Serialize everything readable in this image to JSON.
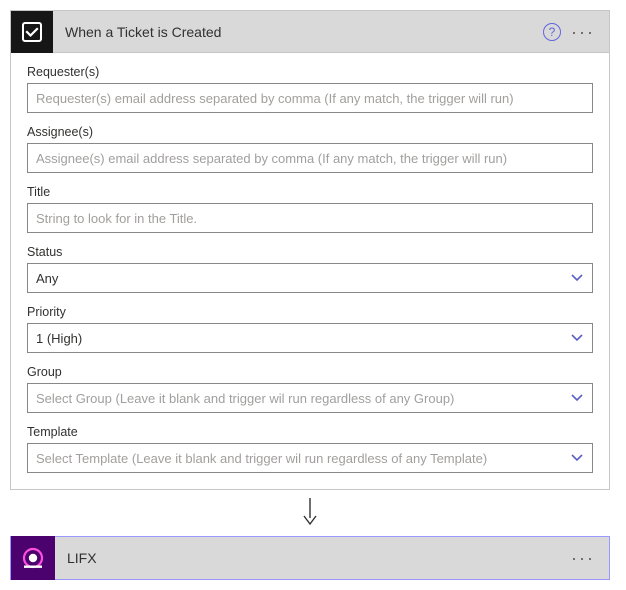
{
  "triggerCard": {
    "title": "When a Ticket is Created",
    "helpTooltip": "?",
    "fields": {
      "requester": {
        "label": "Requester(s)",
        "placeholder": "Requester(s) email address separated by comma (If any match, the trigger will run)",
        "value": ""
      },
      "assignee": {
        "label": "Assignee(s)",
        "placeholder": "Assignee(s) email address separated by comma (If any match, the trigger will run)",
        "value": ""
      },
      "title": {
        "label": "Title",
        "placeholder": "String to look for in the Title.",
        "value": ""
      },
      "status": {
        "label": "Status",
        "selected": "Any"
      },
      "priority": {
        "label": "Priority",
        "selected": "1 (High)"
      },
      "group": {
        "label": "Group",
        "placeholder": "Select Group (Leave it blank and trigger wil run regardless of any Group)"
      },
      "template": {
        "label": "Template",
        "placeholder": "Select Template (Leave it blank and trigger wil run regardless of any Template)"
      }
    }
  },
  "actionCard": {
    "title": "LIFX"
  }
}
